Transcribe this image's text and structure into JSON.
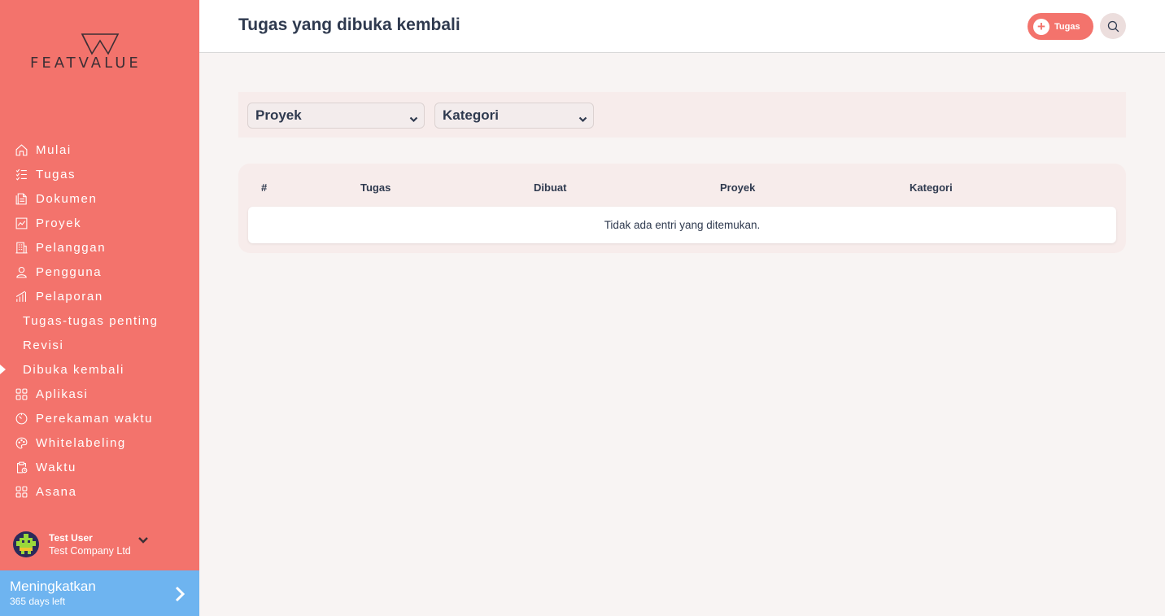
{
  "brand": {
    "name": "FEATVALUE",
    "accent": "#f3736c",
    "upgrade_color": "#6eb4f0"
  },
  "sidebar": {
    "items": [
      {
        "label": "Mulai",
        "icon": "home-icon"
      },
      {
        "label": "Tugas",
        "icon": "checklist-icon"
      },
      {
        "label": "Dokumen",
        "icon": "document-icon"
      },
      {
        "label": "Proyek",
        "icon": "chart-icon"
      },
      {
        "label": "Pelanggan",
        "icon": "building-icon"
      },
      {
        "label": "Pengguna",
        "icon": "user-icon"
      },
      {
        "label": "Pelaporan",
        "icon": "bars-icon"
      },
      {
        "label": "Tugas-tugas penting"
      },
      {
        "label": "Revisi"
      },
      {
        "label": "Dibuka kembali",
        "active": true
      },
      {
        "label": "Aplikasi",
        "icon": "apps-icon"
      },
      {
        "label": "Perekaman waktu",
        "icon": "timer-icon"
      },
      {
        "label": "Whitelabeling",
        "icon": "palette-icon"
      },
      {
        "label": "Waktu",
        "icon": "clipboard-clock-icon"
      },
      {
        "label": "Asana",
        "icon": "apps-icon"
      }
    ],
    "user": {
      "name": "Test User",
      "company": "Test Company Ltd"
    },
    "upgrade": {
      "title": "Meningkatkan",
      "subtitle": "365 days left"
    }
  },
  "header": {
    "title": "Tugas yang dibuka kembali",
    "add_task_label": "Tugas"
  },
  "filters": {
    "project": "Proyek",
    "category": "Kategori"
  },
  "table": {
    "columns": [
      "#",
      "Tugas",
      "Dibuat",
      "Proyek",
      "Kategori"
    ],
    "empty_message": "Tidak ada entri yang ditemukan."
  }
}
